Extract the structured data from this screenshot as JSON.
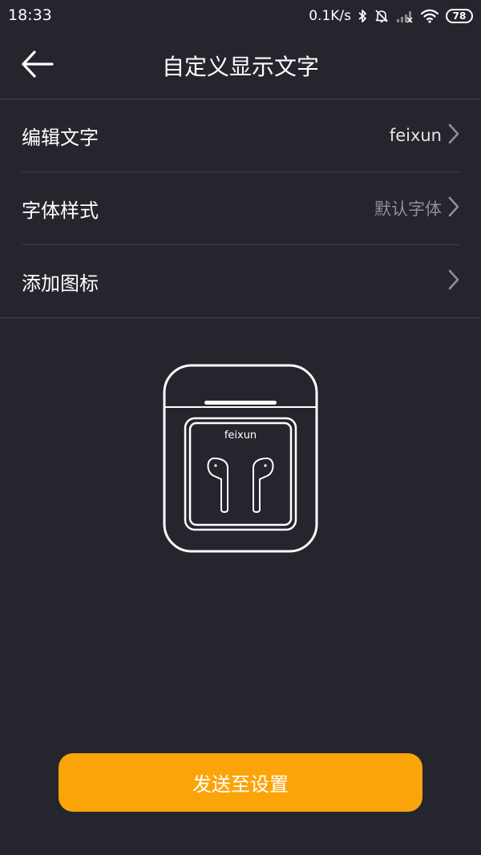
{
  "status_bar": {
    "time": "18:33",
    "net_speed": "0.1K/s",
    "battery_level": "78",
    "icons": [
      "bluetooth-icon",
      "mute-icon",
      "signal-icon",
      "wifi-icon",
      "battery-icon"
    ]
  },
  "header": {
    "back_icon": "back-arrow-icon",
    "title": "自定义显示文字"
  },
  "settings": {
    "items": [
      {
        "label": "编辑文字",
        "value": "feixun",
        "value_style": "primary",
        "icon": "chevron-right-icon"
      },
      {
        "label": "字体样式",
        "value": "默认字体",
        "value_style": "muted",
        "icon": "chevron-right-icon"
      },
      {
        "label": "添加图标",
        "value": "",
        "icon": "chevron-right-icon"
      }
    ]
  },
  "preview": {
    "case_text": "feixun",
    "icon": "earbuds-case-icon"
  },
  "actions": {
    "send_label": "发送至设置"
  },
  "colors": {
    "background": "#25262d",
    "accent": "#fba40a",
    "divider": "#3d3e45",
    "muted_text": "#8e8f96"
  }
}
